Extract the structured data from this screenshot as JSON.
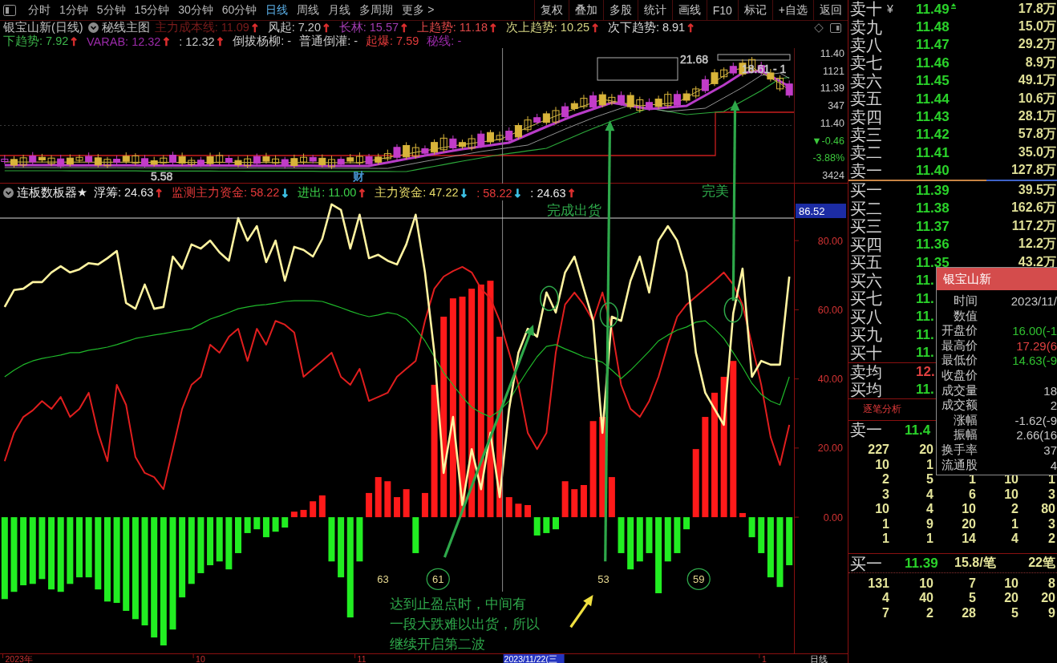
{
  "toolbar": {
    "periods": [
      {
        "label": "分时",
        "selected": false
      },
      {
        "label": "1分钟",
        "selected": false
      },
      {
        "label": "5分钟",
        "selected": false
      },
      {
        "label": "15分钟",
        "selected": false
      },
      {
        "label": "30分钟",
        "selected": false
      },
      {
        "label": "60分钟",
        "selected": false
      },
      {
        "label": "日线",
        "selected": true
      },
      {
        "label": "周线",
        "selected": false
      },
      {
        "label": "月线",
        "selected": false
      },
      {
        "label": "多周期",
        "selected": false
      },
      {
        "label": "更多 >",
        "selected": false
      }
    ],
    "actions": [
      "复权",
      "叠加",
      "多股",
      "统计",
      "画线",
      "F10",
      "标记",
      "+自选",
      "返回"
    ]
  },
  "main_chart": {
    "title": "银宝山新(日线)",
    "formula": "秘线主图",
    "legend_rows": [
      [
        {
          "text": "主力成本线: 11.09",
          "color": "#7c1c1c",
          "arrow": {
            "text": "↑",
            "color": "#e03030"
          }
        },
        {
          "text": "风起: 7.20",
          "color": "#c8c8c8",
          "arrow": {
            "text": "↑",
            "color": "#e03030"
          }
        },
        {
          "text": "长林: 15.57",
          "color": "#a33cb0",
          "arrow": {
            "text": "↑",
            "color": "#e03030"
          }
        },
        {
          "text": "上趋势: 11.18",
          "color": "#e04848",
          "arrow": {
            "text": "↑",
            "color": "#e03030"
          }
        },
        {
          "text": "次上趋势: 10.25",
          "color": "#d2d282",
          "arrow": {
            "text": "↑",
            "color": "#e03030"
          }
        },
        {
          "text": "次下趋势: 8.91",
          "color": "#d8d8d8",
          "arrow": {
            "text": "↑",
            "color": "#e03030"
          }
        }
      ],
      [
        {
          "text": "下趋势: 7.92",
          "color": "#3cb44a",
          "arrow": {
            "text": "↑",
            "color": "#e03030"
          }
        },
        {
          "text": "VARAB: 12.32",
          "color": "#9a2aa8",
          "arrow": {
            "text": "↑",
            "color": "#e03030"
          }
        },
        {
          "text": ": 12.32",
          "color": "#c8c8c8",
          "arrow": {
            "text": "↑",
            "color": "#e03030"
          }
        },
        {
          "text": "倒拔杨柳: -",
          "color": "#c8c8c8"
        },
        {
          "text": "普通倒灌: -",
          "color": "#c8c8c8"
        },
        {
          "text": "起爆: 7.59",
          "color": "#e03a3a"
        },
        {
          "text": "秘线: -",
          "color": "#9a2aa8"
        }
      ]
    ],
    "labels": [
      {
        "text": "21.68",
        "color": "#c8c8c8"
      },
      {
        "text": "18.61 - 1",
        "color": "#c8c8c8"
      },
      {
        "text": "5.58",
        "color": "#c8c8c8"
      },
      {
        "text": "财",
        "color": "#4a9ad8"
      }
    ],
    "axis_labels": [
      {
        "text": "11.40",
        "color": "#c8c8c8"
      },
      {
        "text": "1121",
        "color": "#c8c8c8"
      },
      {
        "text": "11.39",
        "color": "#c8c8c8"
      },
      {
        "text": "347",
        "color": "#c8c8c8"
      },
      {
        "text": "11.40",
        "color": "#c8c8c8"
      },
      {
        "text": "▼-0.46",
        "color": "#3cc83c"
      },
      {
        "text": "-3.88%",
        "color": "#3cc83c"
      },
      {
        "text": "3424",
        "color": "#c8c8c8"
      }
    ]
  },
  "indicator_panel": {
    "title": "连板数板器★",
    "legend": [
      {
        "text": "浮筹: 24.63",
        "color": "#e8e8e8",
        "arrow": {
          "text": "↑",
          "color": "#e03030"
        }
      },
      {
        "text": "监测主力资金: 58.22",
        "color": "#e83a3a",
        "arrow": {
          "text": "↓",
          "color": "#3ec4e8"
        }
      },
      {
        "text": "进出: 11.00",
        "color": "#3cd24a",
        "arrow": {
          "text": "↑",
          "color": "#e03030"
        }
      },
      {
        "text": "主力资金: 47.22",
        "color": "#e8dc6a",
        "arrow": {
          "text": "↓",
          "color": "#3ec4e8"
        }
      },
      {
        "text": ": 58.22",
        "color": "#e83a3a",
        "arrow": {
          "text": "↓",
          "color": "#3ec4e8"
        }
      },
      {
        "text": ": 24.63",
        "color": "#e8e8e8",
        "arrow": {
          "text": "↑",
          "color": "#e03030"
        }
      }
    ],
    "chart_data": {
      "type": "line",
      "ylim": [
        -39.4,
        96.5
      ],
      "yticks": [
        {
          "value": 0,
          "label": "0.00"
        },
        {
          "value": 20,
          "label": "20.00"
        },
        {
          "value": 40,
          "label": "40.00"
        },
        {
          "value": 60,
          "label": "60.00"
        },
        {
          "value": 80,
          "label": "80.00"
        }
      ],
      "series": [
        {
          "type": "bar",
          "color": "#ff1a1a",
          "values": [
            null,
            null,
            null,
            null,
            null,
            null,
            null,
            null,
            null,
            null,
            null,
            null,
            null,
            null,
            null,
            null,
            null,
            null,
            null,
            null,
            null,
            null,
            null,
            null,
            null,
            null,
            null,
            null,
            null,
            null,
            null,
            1.6,
            2.1,
            4.6,
            6.3,
            null,
            null,
            null,
            null,
            7,
            11.6,
            10.4,
            5.8,
            8.1,
            null,
            7,
            38.3,
            58,
            63.3,
            63.8,
            66.1,
            67.3,
            68.4,
            52.2,
            5.8,
            3.9,
            3.5,
            null,
            null,
            null,
            10.4,
            8.1,
            9.3,
            27.8,
            29,
            11.6,
            null,
            null,
            null,
            null,
            null,
            null,
            null,
            null,
            19.7,
            29,
            36,
            40.6,
            45.2,
            1.2,
            null,
            null,
            null,
            null,
            null
          ]
        },
        {
          "type": "bar",
          "color": "#22ee22",
          "values": [
            -23.7,
            -21.6,
            -19.7,
            -19.3,
            -17.9,
            -20.9,
            -21.6,
            -19.3,
            -17.4,
            -17.4,
            -20.9,
            -24.4,
            -24.8,
            -27.1,
            -29.5,
            -31.3,
            -34.8,
            -37.1,
            -32.5,
            -23.2,
            -19.3,
            -16.2,
            -13.9,
            -12.8,
            -15.1,
            -10.4,
            -4.6,
            -3.5,
            -5.8,
            -4.2,
            -3,
            null,
            null,
            null,
            null,
            -12.8,
            -17.4,
            -29,
            -12.8,
            null,
            null,
            null,
            null,
            null,
            -10.4,
            null,
            null,
            null,
            null,
            null,
            null,
            null,
            null,
            null,
            null,
            null,
            null,
            -5.3,
            -4.6,
            -3.5,
            null,
            null,
            null,
            null,
            null,
            null,
            -10.4,
            -15.1,
            -12.8,
            -10.4,
            -22,
            -12.8,
            -10.4,
            -3.5,
            null,
            null,
            null,
            null,
            null,
            null,
            -5.8,
            -10.4,
            -17.4,
            -20.2,
            -13.9
          ]
        },
        {
          "color": "#e01e1e",
          "values": [
            16.2,
            24.4,
            29,
            30.9,
            33.6,
            31.3,
            34.8,
            29,
            31.3,
            36,
            24.4,
            16.2,
            38.3,
            32.5,
            17.4,
            12.8,
            11.6,
            8.1,
            19.7,
            31.3,
            38.3,
            40.6,
            49.9,
            47.6,
            52.2,
            54.5,
            45.2,
            54.5,
            49.9,
            56.8,
            55.7,
            53.4,
            40.6,
            42.9,
            45.2,
            47.6,
            40.6,
            38.3,
            42.9,
            33.6,
            34.8,
            36,
            40.6,
            42.9,
            45.2,
            56.8,
            66.1,
            69.6,
            71.2,
            72.4,
            70.8,
            66.1,
            63.3,
            56.8,
            47.6,
            38.3,
            24.4,
            19.7,
            24.4,
            47.6,
            61.5,
            65,
            61.5,
            56.8,
            65,
            54.5,
            38.3,
            31.3,
            29,
            33.6,
            40.6,
            49.9,
            58,
            61.5,
            63.8,
            66.1,
            68.4,
            70.8,
            67.3,
            61.5,
            49.9,
            38.3,
            23.2,
            15.1,
            26.7
          ]
        },
        {
          "color": "#1fb82a",
          "values": [
            40.6,
            42.5,
            44.1,
            45.2,
            45.9,
            46.4,
            46.9,
            47.6,
            47.6,
            48.3,
            48.7,
            49.2,
            49.9,
            50.8,
            51.7,
            52.2,
            52.7,
            53.1,
            53.6,
            54.1,
            54.5,
            55.9,
            57.3,
            58.2,
            59.2,
            60.3,
            60.8,
            61.3,
            61.5,
            61.9,
            62.4,
            62.6,
            62.6,
            62.6,
            62.4,
            61.5,
            60.6,
            59.6,
            58.7,
            58,
            58.5,
            59.2,
            58.7,
            57.3,
            54.5,
            51,
            46.4,
            41.8,
            38.3,
            34.8,
            31.8,
            30.2,
            29,
            30.9,
            33.6,
            38.3,
            42.5,
            46.4,
            49.4,
            49.9,
            48.7,
            47.6,
            46.4,
            45.7,
            44.8,
            42.5,
            40.1,
            42.5,
            45.2,
            48,
            51,
            52.7,
            54.1,
            55,
            56.4,
            56.8,
            54.5,
            51.7,
            47.6,
            43.4,
            38.7,
            35.5,
            33.6,
            32.5,
            40.6
          ]
        },
        {
          "color": "#fff3a0",
          "values": [
            60.8,
            65.7,
            66.1,
            68,
            68,
            70.8,
            72.6,
            70.8,
            71.7,
            73.5,
            73.1,
            74.9,
            77,
            62,
            60.3,
            67.3,
            60.3,
            60.8,
            75.4,
            71.9,
            78.9,
            77.7,
            80,
            76.6,
            74.2,
            86.5,
            80,
            84.2,
            73.8,
            80,
            68.4,
            78.2,
            77.3,
            75.4,
            80.5,
            90.5,
            88.9,
            77.7,
            87.5,
            74.9,
            75.9,
            74.2,
            73.1,
            78.9,
            87.5,
            70.8,
            47.6,
            12.8,
            29,
            3.5,
            19.7,
            8.1,
            24.4,
            5.8,
            31.3,
            47.6,
            54.5,
            52.2,
            65,
            59.2,
            70.8,
            75.4,
            66.1,
            56.8,
            24.4,
            58,
            56.8,
            68.4,
            75.4,
            65,
            80,
            84.2,
            80,
            70.8,
            47.6,
            36,
            31.3,
            26.7,
            59,
            71.9,
            40.6,
            45.2,
            44.1,
            44.1,
            69.6
          ]
        }
      ],
      "annotations": [
        "完成出货",
        "完美"
      ]
    },
    "crosshair": {
      "value_label": "86.52",
      "date_label": "2023/11/22(三"
    },
    "markers": [
      {
        "text": "63",
        "circled": false
      },
      {
        "text": "61",
        "circled": true
      },
      {
        "text": "53",
        "circled": false
      },
      {
        "text": "59",
        "circled": true
      }
    ],
    "note": [
      "达到止盈点时，中间有",
      "一段大跌难以出货，所以",
      "继续开启第二波"
    ]
  },
  "time_axis": {
    "labels": [
      "2023年",
      "10",
      "11",
      "1"
    ],
    "period": "日线"
  },
  "order_book": {
    "asks": [
      {
        "label": "卖十",
        "symbol": "¥",
        "price": "11.49",
        "volume": "17.8万",
        "marked": true
      },
      {
        "label": "卖九",
        "price": "11.48",
        "volume": "15.0万",
        "marked": false
      },
      {
        "label": "卖八",
        "price": "11.47",
        "volume": "29.2万",
        "marked": false
      },
      {
        "label": "卖七",
        "price": "11.46",
        "volume": "8.9万",
        "marked": false
      },
      {
        "label": "卖六",
        "price": "11.45",
        "volume": "49.1万",
        "marked": false
      },
      {
        "label": "卖五",
        "price": "11.44",
        "volume": "10.6万",
        "marked": false
      },
      {
        "label": "卖四",
        "price": "11.43",
        "volume": "28.1万",
        "marked": false
      },
      {
        "label": "卖三",
        "price": "11.42",
        "volume": "57.8万",
        "marked": false
      },
      {
        "label": "卖二",
        "price": "11.41",
        "volume": "35.0万",
        "marked": false
      },
      {
        "label": "卖一",
        "price": "11.40",
        "volume": "127.8万",
        "marked": false
      }
    ],
    "bids": [
      {
        "label": "买一",
        "price": "11.39",
        "volume": "39.5万"
      },
      {
        "label": "买二",
        "price": "11.38",
        "volume": "162.6万"
      },
      {
        "label": "买三",
        "price": "11.37",
        "volume": "117.2万"
      },
      {
        "label": "买四",
        "price": "11.36",
        "volume": "12.2万"
      },
      {
        "label": "买五",
        "price": "11.35",
        "volume": "43.2万"
      },
      {
        "label": "买六",
        "price": "11."
      },
      {
        "label": "买七",
        "price": "11."
      },
      {
        "label": "买八",
        "price": "11."
      },
      {
        "label": "买九",
        "price": "11."
      },
      {
        "label": "买十",
        "price": "11."
      }
    ],
    "averages": [
      {
        "label": "卖均",
        "price": "12.",
        "color": "#e04040"
      },
      {
        "label": "买均",
        "price": "11.",
        "color": "#2ad22a"
      }
    ]
  },
  "tick_analysis": {
    "title": "逐笔分析",
    "ask": {
      "label": "卖一",
      "price": "11.4"
    },
    "ask_rows": [
      [
        "227",
        "20"
      ],
      [
        "10",
        "1"
      ],
      [
        "2",
        "5",
        "1",
        "10",
        "1"
      ],
      [
        "3",
        "4",
        "6",
        "10",
        "3"
      ],
      [
        "10",
        "4",
        "10",
        "2",
        "80"
      ],
      [
        "1",
        "9",
        "20",
        "1",
        "3"
      ],
      [
        "1",
        "1",
        "14",
        "4",
        "2"
      ]
    ],
    "bid": {
      "label": "买一",
      "price": "11.39",
      "average": "15.8/笔",
      "count": "22笔"
    },
    "bid_rows": [
      [
        "131",
        "10",
        "7",
        "10",
        "8"
      ],
      [
        "4",
        "40",
        "5",
        "20",
        "20"
      ],
      [
        "7",
        "2",
        "28",
        "5",
        "9"
      ]
    ]
  },
  "popup": {
    "title": "银宝山新",
    "rows": [
      {
        "label": "时间",
        "value": "2023/11/",
        "color": "#c8c8c8"
      },
      {
        "label": "数值"
      },
      {
        "label": "开盘价",
        "value": "16.00(-1",
        "color": "#30c030"
      },
      {
        "label": "最高价",
        "value": "17.29(6",
        "color": "#e04040"
      },
      {
        "label": "最低价",
        "value": "14.63(-9",
        "color": "#30c030"
      },
      {
        "label": "收盘价"
      },
      {
        "label": "成交量",
        "value": "18",
        "color": "#c8c8c8"
      },
      {
        "label": "成交额",
        "value": "2",
        "color": "#c8c8c8"
      },
      {
        "label": "涨幅",
        "value": "-1.62(-9",
        "color": "#c8c8c8"
      },
      {
        "label": "振幅",
        "value": "2.66(16",
        "color": "#c8c8c8"
      },
      {
        "label": "换手率",
        "value": "37",
        "color": "#c8c8c8"
      },
      {
        "label": "流通股",
        "value": "4",
        "color": "#c8c8c8"
      }
    ]
  }
}
